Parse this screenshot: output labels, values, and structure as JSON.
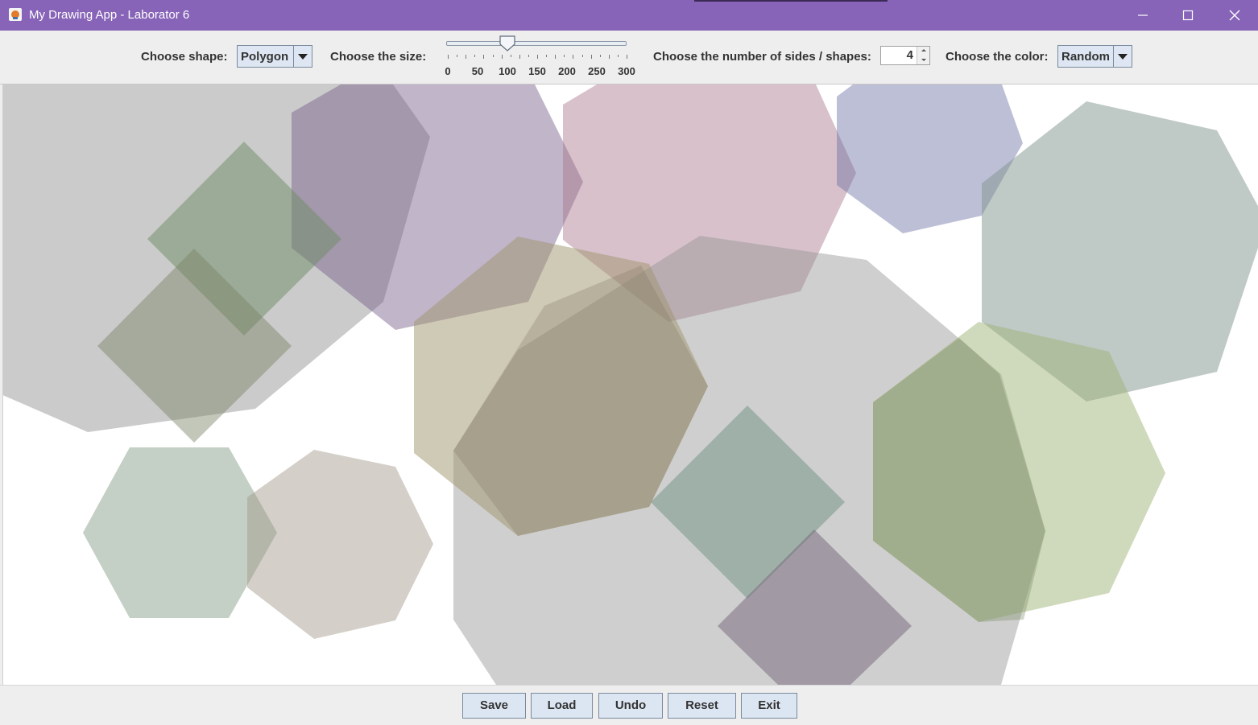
{
  "window": {
    "title": "My Drawing App - Laborator 6",
    "icon": "java-cup-icon",
    "controls": [
      "minimize-icon",
      "maximize-icon",
      "close-icon"
    ]
  },
  "toolbar": {
    "shape_label": "Choose shape:",
    "shape_value": "Polygon",
    "size_label": "Choose the size:",
    "size_slider": {
      "value": 100,
      "min": 0,
      "max": 300,
      "tick_labels": [
        "0",
        "50",
        "100",
        "150",
        "200",
        "250",
        "300"
      ]
    },
    "sides_label": "Choose the number of sides / shapes:",
    "sides_value": "4",
    "color_label": "Choose the color:",
    "color_value": "Random"
  },
  "buttons": {
    "save": "Save",
    "load": "Load",
    "undo": "Undo",
    "reset": "Reset",
    "exit": "Exit"
  },
  "colors": {
    "title_bar": "#8764b8",
    "canvas_background": "#ffffff",
    "button_face": "#dce6f3"
  }
}
